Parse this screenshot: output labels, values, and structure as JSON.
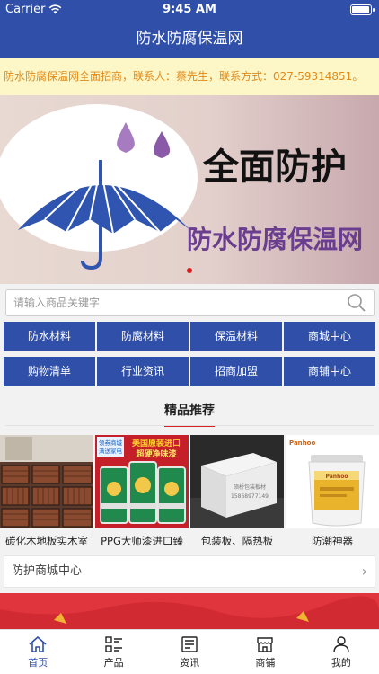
{
  "status_bar": {
    "carrier": "Carrier",
    "time": "9:45 AM",
    "battery_level": 0.95
  },
  "nav": {
    "title": "防水防腐保温网"
  },
  "notice": {
    "text": "防水防腐保温网全面招商，联系人：蔡先生，联系方式：027-59314851。"
  },
  "banner": {
    "headline": "全面防护",
    "subline": "防水防腐保温网",
    "page_count": 1,
    "active_page": 1
  },
  "search": {
    "placeholder": "请输入商品关键字"
  },
  "categories": [
    {
      "label": "防水材料"
    },
    {
      "label": "防腐材料"
    },
    {
      "label": "保温材料"
    },
    {
      "label": "商城中心"
    },
    {
      "label": "购物清单"
    },
    {
      "label": "行业资讯"
    },
    {
      "label": "招商加盟"
    },
    {
      "label": "商铺中心"
    }
  ],
  "featured": {
    "title": "精品推荐",
    "products": [
      {
        "name": "碳化木地板实木室"
      },
      {
        "name": "PPG大师漆进口臻",
        "img_text_1": "领券商城",
        "img_text_2": "满送家电",
        "img_text_3": "美国原装进口",
        "img_text_4": "超硬净味漆"
      },
      {
        "name": "包装板、隔热板",
        "img_text_1": "硕桥包装板材",
        "img_text_2": "15868977149"
      },
      {
        "name": "防潮神器",
        "img_text_1": "Panhoo"
      }
    ]
  },
  "mall_link": {
    "label": "防护商城中心",
    "chevron": "›"
  },
  "tabs": [
    {
      "label": "首页",
      "icon": "home-icon",
      "active": true
    },
    {
      "label": "产品",
      "icon": "grid-list-icon",
      "active": false
    },
    {
      "label": "资讯",
      "icon": "news-icon",
      "active": false
    },
    {
      "label": "商铺",
      "icon": "store-icon",
      "active": false
    },
    {
      "label": "我的",
      "icon": "user-icon",
      "active": false
    }
  ],
  "colors": {
    "primary": "#2f4fa8",
    "accent": "#d61f1f",
    "notice_text": "#e08a1a",
    "notice_bg": "#fdf6c7"
  }
}
